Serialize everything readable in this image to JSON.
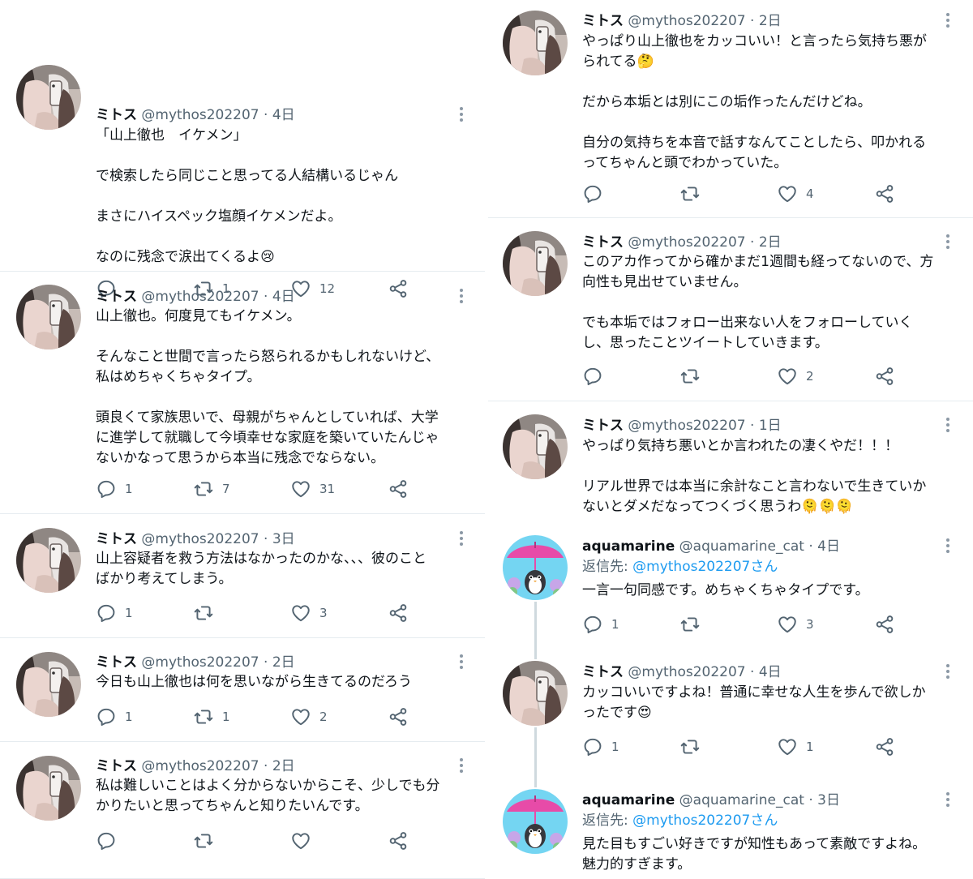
{
  "user": {
    "name": "ミトス",
    "handle": "@mythos202207"
  },
  "reply_user": {
    "name": "aquamarine",
    "handle": "@aquamarine_cat"
  },
  "colors": {
    "text": "#0f1419",
    "secondary": "#536471",
    "link": "#1d9bf0",
    "divider": "#e6ecf0"
  },
  "icons": {
    "reply": "reply-icon",
    "retweet": "retweet-icon",
    "like": "heart-icon",
    "share": "share-icon",
    "more": "more-icon"
  },
  "left_column": [
    {
      "time": "4日",
      "text": "「山上徹也　イケメン」\n\nで検索したら同じこと思ってる人結構いるじゃん\n\nまさにハイスペック塩顔イケメンだよ。\n\nなのに残念で涙出てくるよ😢",
      "replies": "",
      "retweets": "1",
      "likes": "12"
    },
    {
      "time": "4日",
      "text": "山上徹也。何度見てもイケメン。\n\nそんなこと世間で言ったら怒られるかもしれないけど、\n私はめちゃくちゃタイプ。\n\n頭良くて家族思いで、母親がちゃんとしていれば、大学\nに進学して就職して今頃幸せな家庭を築いていたんじゃ\nないかなって思うから本当に残念でならない。",
      "replies": "1",
      "retweets": "7",
      "likes": "31"
    },
    {
      "time": "3日",
      "text": "山上容疑者を救う方法はなかったのかな、、、彼のこと\nばかり考えてしまう。",
      "replies": "1",
      "retweets": "",
      "likes": "3"
    },
    {
      "time": "2日",
      "text": "今日も山上徹也は何を思いながら生きてるのだろう",
      "replies": "1",
      "retweets": "1",
      "likes": "2"
    },
    {
      "time": "2日",
      "text": "私は難しいことはよく分からないからこそ、少しでも分\nかりたいと思ってちゃんと知りたいんです。",
      "replies": "",
      "retweets": "",
      "likes": ""
    }
  ],
  "right_column": [
    {
      "time": "2日",
      "text": "やっぱり山上徹也をカッコいい！と言ったら気持ち悪が\nられてる🤔\n\nだから本垢とは別にこの垢作ったんだけどね。\n\n自分の気持ちを本音で話すなんてことしたら、叩かれる\nってちゃんと頭でわかっていた。",
      "replies": "",
      "retweets": "",
      "likes": "4"
    },
    {
      "time": "2日",
      "text": "このアカ作ってから確かまだ1週間も経ってないので、方\n向性も見出せていません。\n\nでも本垢ではフォロー出来ない人をフォローしていく\nし、思ったことツイートしていきます。",
      "replies": "",
      "retweets": "",
      "likes": "2"
    },
    {
      "time": "1日",
      "text": "やっぱり気持ち悪いとか言われたの凄くやだ！！！\n\nリアル世界では本当に余計なこと言わないで生きていか\nないとダメだなってつくづく思うわ🫠🫠🫠"
    },
    {
      "time": "4日",
      "reply_label": "返信先: ",
      "reply_mention": "@mythos202207さん",
      "text": "一言一句同感です。めちゃくちゃタイプです。",
      "replies": "1",
      "retweets": "",
      "likes": "3"
    },
    {
      "time": "4日",
      "text": "カッコいいですよね！普通に幸せな人生を歩んで欲しか\nったです😍",
      "replies": "1",
      "retweets": "",
      "likes": "1"
    },
    {
      "time": "3日",
      "reply_label": "返信先: ",
      "reply_mention": "@mythos202207さん",
      "text": "見た目もすごい好きですが知性もあって素敵ですよね。\n魅力的すぎます。"
    }
  ]
}
